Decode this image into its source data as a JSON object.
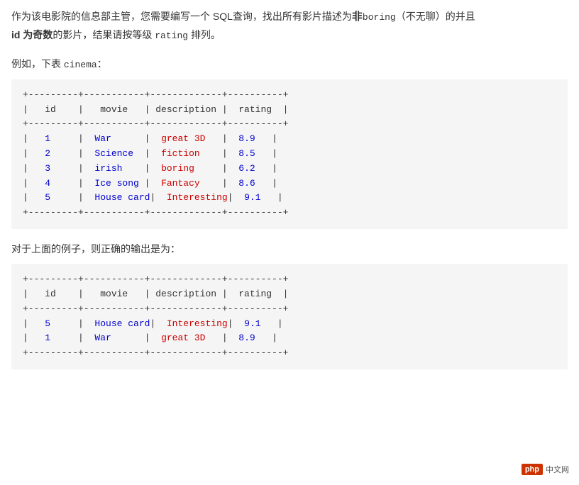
{
  "intro": {
    "line1": "作为该电影院的信息部主管，您需要编写一个 SQL查询，找出所有影片描述为",
    "not_keyword": "非",
    "boring_code": "boring",
    "line1_end": "（不无聊）的并且",
    "line2_start": "id 为奇数",
    "id_bold": "id 为奇数",
    "line2_end": "的影片，结果请按等级",
    "rating_code": "rating",
    "line2_final": "排列。"
  },
  "example_label": "例如，下表",
  "cinema_code": "cinema",
  "example_colon": "：",
  "output_label": "对于上面的例子，则正确的输出是为：",
  "cinema_table": {
    "separator_top": "+---------+-----------+-------------+----------+",
    "header": "|   id    |   movie   | description |  rating  |",
    "separator_mid": "+---------+-----------+-------------+----------+",
    "rows": [
      {
        "id": "   1   ",
        "movie": "  War      ",
        "desc": "  great 3D   ",
        "rating": "  8.9   "
      },
      {
        "id": "   2   ",
        "movie": "  Science  ",
        "desc": "  fiction    ",
        "rating": "  8.5   "
      },
      {
        "id": "   3   ",
        "movie": "  irish    ",
        "desc": "  boring     ",
        "rating": "  6.2   "
      },
      {
        "id": "   4   ",
        "movie": "  Ice song ",
        "desc": "  Fantacy    ",
        "rating": "  8.6   "
      },
      {
        "id": "   5   ",
        "movie": "  House card",
        "desc": "  Interesting",
        "rating": "  9.1   "
      }
    ],
    "separator_bot": "+---------+-----------+-------------+----------+"
  },
  "result_table": {
    "separator_top": "+---------+-----------+-------------+----------+",
    "header": "|   id    |   movie   | description |  rating  |",
    "separator_mid": "+---------+-----------+-------------+----------+",
    "rows": [
      {
        "id": "   5   ",
        "movie": "  House card",
        "desc": "  Interesting",
        "rating": "  9.1   "
      },
      {
        "id": "   1   ",
        "movie": "  War      ",
        "desc": "  great 3D   ",
        "rating": "  8.9   "
      }
    ],
    "separator_bot": "+---------+-----------+-------------+----------+"
  },
  "watermark": {
    "box_text": "php",
    "site_text": "中文网",
    "url": "https://blog.csdn.net/weixin_44859064"
  }
}
